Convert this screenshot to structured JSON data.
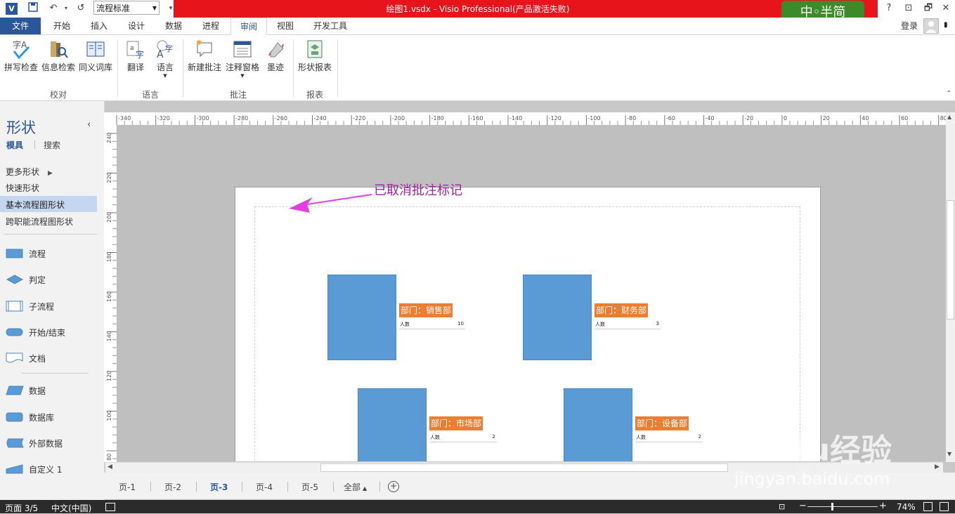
{
  "title": "绘图1.vsdx -  Visio Professional(产品激活失败)",
  "quick_access": {
    "style_combo": "流程标准"
  },
  "ime": "中◦半简",
  "window_buttons": {
    "help": "?",
    "restore_ribbon": "⊡",
    "minimize": "—",
    "maximize": "🗗",
    "close": "✕"
  },
  "account": {
    "login": "登录"
  },
  "tabs": [
    "文件",
    "开始",
    "插入",
    "设计",
    "数据",
    "进程",
    "审阅",
    "视图",
    "开发工具"
  ],
  "active_tab": "审阅",
  "ribbon": {
    "groups": [
      {
        "label": "校对",
        "buttons": [
          "拼写检查",
          "信息检索",
          "同义词库"
        ]
      },
      {
        "label": "语言",
        "buttons": [
          "翻译",
          "语言"
        ]
      },
      {
        "label": "批注",
        "buttons": [
          "新建批注",
          "注释窗格",
          "墨迹"
        ]
      },
      {
        "label": "报表",
        "buttons": [
          "形状报表"
        ]
      }
    ]
  },
  "shapes_pane": {
    "title": "形状",
    "subtabs": [
      "模具",
      "搜索"
    ],
    "menu": [
      "更多形状",
      "快速形状",
      "基本流程图形状",
      "跨职能流程图形状"
    ],
    "selected_menu": "基本流程图形状",
    "stencils": [
      "流程",
      "判定",
      "子流程",
      "开始/结束",
      "文档",
      "数据",
      "数据库",
      "外部数据",
      "自定义 1"
    ]
  },
  "ruler": {
    "h_ticks": [
      "-340",
      "-320",
      "-300",
      "-280",
      "-260",
      "-240",
      "-220",
      "-200",
      "-180",
      "-160",
      "-140",
      "-120",
      "-100",
      "-80",
      "-60",
      "-40",
      "-20",
      "0",
      "20",
      "40",
      "60",
      "80"
    ],
    "v_ticks": [
      "240",
      "220",
      "200",
      "180",
      "160",
      "140",
      "120",
      "100",
      "80"
    ]
  },
  "annotation": "已取消批注标记",
  "diagram": {
    "departments": [
      {
        "name": "部门：销售部",
        "count_label": "人数",
        "count": "10"
      },
      {
        "name": "部门：财务部",
        "count_label": "人数",
        "count": "3"
      },
      {
        "name": "部门：市场部",
        "count_label": "人数",
        "count": "2"
      },
      {
        "name": "部门：设备部",
        "count_label": "人数",
        "count": "2"
      }
    ]
  },
  "page_tabs": [
    "页-1",
    "页-2",
    "页-3",
    "页-4",
    "页-5",
    "全部"
  ],
  "active_page": "页-3",
  "status": {
    "page": "页面 3/5",
    "language": "中文(中国)",
    "zoom": "74%"
  },
  "watermark": {
    "logo": "Baidu经验",
    "url": "jingyan.baidu.com"
  },
  "colors": {
    "accent": "#2b579a",
    "title_bar": "#e8141b",
    "shape_fill": "#5b9bd5",
    "label_fill": "#ed7d31",
    "annotation": "#a020a0"
  }
}
